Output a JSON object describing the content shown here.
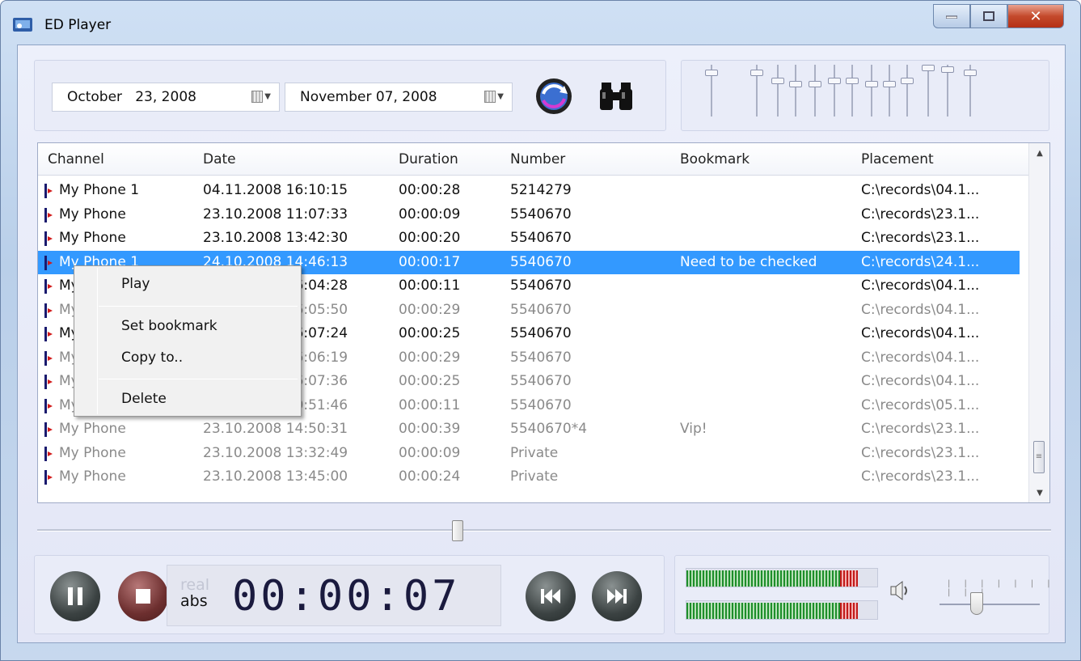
{
  "window": {
    "title": "ED Player"
  },
  "dates": {
    "from": "October   23, 2008",
    "to": "November 07, 2008"
  },
  "icons": {
    "refresh": "refresh-icon",
    "search": "binoculars-icon",
    "channel": "channel-phone-icon",
    "speaker": "speaker-icon"
  },
  "equalizer": {
    "bands": 12
  },
  "table": {
    "columns": [
      "Channel",
      "Date",
      "Duration",
      "Number",
      "Bookmark",
      "Placement"
    ],
    "rows": [
      {
        "channel": "My Phone 1",
        "date": "04.11.2008 16:10:15",
        "duration": "00:00:28",
        "number": "5214279",
        "bookmark": "",
        "placement": "C:\\records\\04.1...",
        "state": "normal"
      },
      {
        "channel": "My Phone",
        "date": "23.10.2008 11:07:33",
        "duration": "00:00:09",
        "number": "5540670",
        "bookmark": "",
        "placement": "C:\\records\\23.1...",
        "state": "normal"
      },
      {
        "channel": "My Phone",
        "date": "23.10.2008 13:42:30",
        "duration": "00:00:20",
        "number": "5540670",
        "bookmark": "",
        "placement": "C:\\records\\23.1...",
        "state": "normal"
      },
      {
        "channel": "My Phone 1",
        "date": "24.10.2008 14:46:13",
        "duration": "00:00:17",
        "number": "5540670",
        "bookmark": "Need to be checked",
        "placement": "C:\\records\\24.1...",
        "state": "selected"
      },
      {
        "channel": "My Phone",
        "date": "04.11.2008 16:04:28",
        "duration": "00:00:11",
        "number": "5540670",
        "bookmark": "",
        "placement": "C:\\records\\04.1...",
        "state": "normal"
      },
      {
        "channel": "My Phone",
        "date": "04.11.2008 16:05:50",
        "duration": "00:00:29",
        "number": "5540670",
        "bookmark": "",
        "placement": "C:\\records\\04.1...",
        "state": "dim"
      },
      {
        "channel": "My Phone",
        "date": "04.11.2008 16:07:24",
        "duration": "00:00:25",
        "number": "5540670",
        "bookmark": "",
        "placement": "C:\\records\\04.1...",
        "state": "normal"
      },
      {
        "channel": "My Phone",
        "date": "04.11.2008 16:06:19",
        "duration": "00:00:29",
        "number": "5540670",
        "bookmark": "",
        "placement": "C:\\records\\04.1...",
        "state": "dim"
      },
      {
        "channel": "My Phone",
        "date": "04.11.2008 16:07:36",
        "duration": "00:00:25",
        "number": "5540670",
        "bookmark": "",
        "placement": "C:\\records\\04.1...",
        "state": "dim"
      },
      {
        "channel": "My Phone",
        "date": "05.11.2008 10:51:46",
        "duration": "00:00:11",
        "number": "5540670",
        "bookmark": "",
        "placement": "C:\\records\\05.1...",
        "state": "dim"
      },
      {
        "channel": "My Phone",
        "date": "23.10.2008 14:50:31",
        "duration": "00:00:39",
        "number": "5540670*4",
        "bookmark": "Vip!",
        "placement": "C:\\records\\23.1...",
        "state": "dim"
      },
      {
        "channel": "My Phone",
        "date": "23.10.2008 13:32:49",
        "duration": "00:00:09",
        "number": "Private",
        "bookmark": "",
        "placement": "C:\\records\\23.1...",
        "state": "dim"
      },
      {
        "channel": "My Phone",
        "date": "23.10.2008 13:45:00",
        "duration": "00:00:24",
        "number": "Private",
        "bookmark": "",
        "placement": "C:\\records\\23.1...",
        "state": "dim"
      }
    ]
  },
  "context_menu": {
    "play": "Play",
    "set_bookmark": "Set bookmark",
    "copy_to": "Copy to..",
    "delete": "Delete"
  },
  "player": {
    "time": "00:00:07",
    "real_label": "real",
    "abs_label": "abs"
  },
  "levels": {
    "left": 0.9,
    "right": 0.9
  },
  "colors": {
    "selection": "#3399ff",
    "meter_green": "#1d8e2a",
    "meter_red": "#c21a1a"
  }
}
